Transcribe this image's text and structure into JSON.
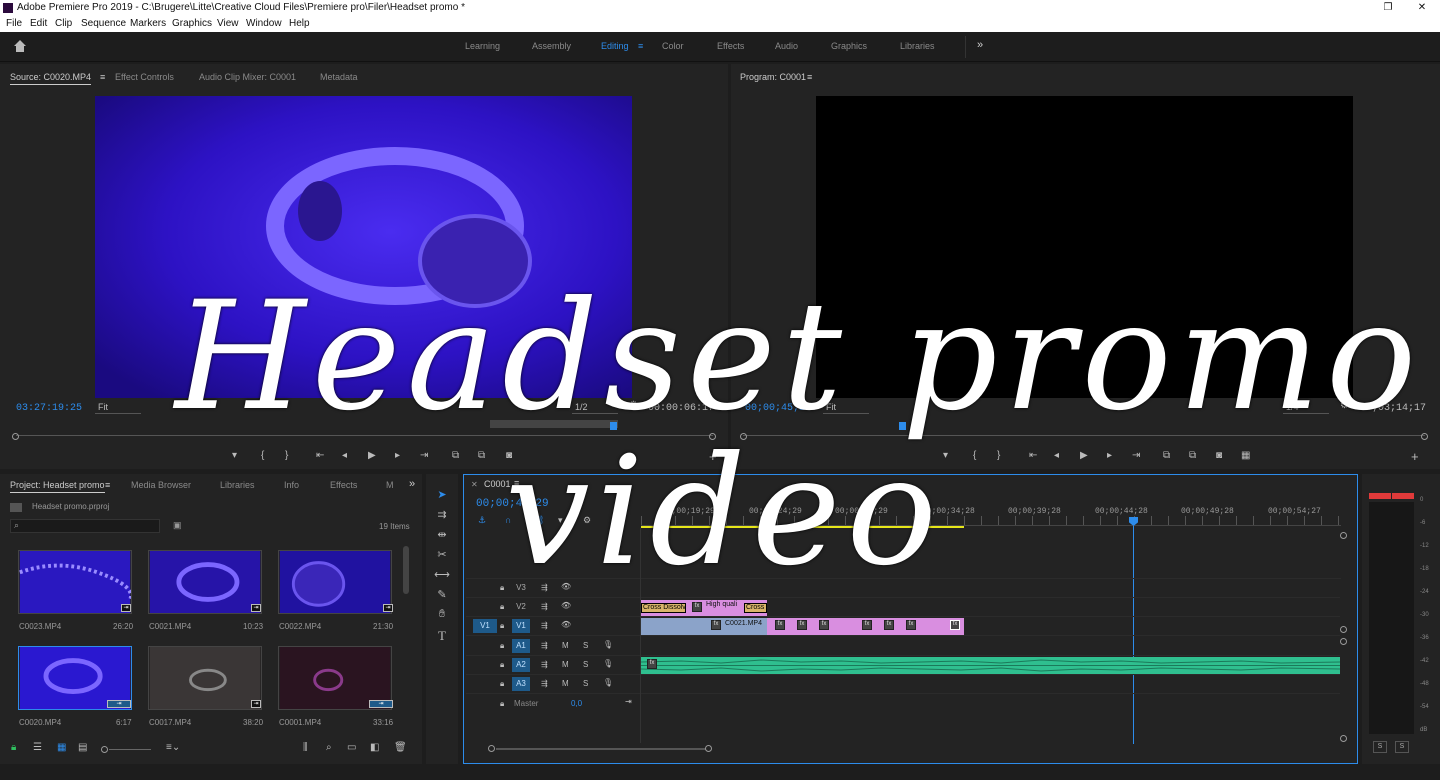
{
  "titlebar": {
    "title": "Adobe Premiere Pro 2019 - C:\\Brugere\\Litte\\Creative Cloud Files\\Premiere pro\\Filer\\Headset promo *",
    "restore": "❐",
    "close": "✕"
  },
  "menu": [
    "File",
    "Edit",
    "Clip",
    "Sequence",
    "Markers",
    "Graphics",
    "View",
    "Window",
    "Help"
  ],
  "workspaces": [
    "Learning",
    "Assembly",
    "Editing",
    "Color",
    "Effects",
    "Audio",
    "Graphics",
    "Libraries"
  ],
  "workspace_active": "Editing",
  "more_glyph": "»",
  "source": {
    "tabs": [
      "Source: C0020.MP4",
      "Effect Controls",
      "Audio Clip Mixer: C0001",
      "Metadata"
    ],
    "timecode": "03:27:19:25",
    "fit": "Fit",
    "resolution": "1/2",
    "duration": "00:00:06:17"
  },
  "program": {
    "tab": "Program: C0001",
    "timecode": "00;00;45;29",
    "fit": "Fit",
    "resolution": "1/4",
    "duration": "00;03;14;17"
  },
  "project": {
    "tabs": [
      "Project: Headset promo",
      "Media Browser",
      "Libraries",
      "Info",
      "Effects",
      "M"
    ],
    "file": "Headset promo.prproj",
    "items_count": "19 Items",
    "clips": [
      {
        "name": "C0023.MP4",
        "duration": "26:20"
      },
      {
        "name": "C0021.MP4",
        "duration": "10:23"
      },
      {
        "name": "C0022.MP4",
        "duration": "21:30"
      },
      {
        "name": "C0020.MP4",
        "duration": "6:17"
      },
      {
        "name": "C0017.MP4",
        "duration": "38:20"
      },
      {
        "name": "C0001.MP4",
        "duration": "33:16"
      }
    ]
  },
  "timeline": {
    "tab": "C0001",
    "timecode": "00;00;45;29",
    "ruler": [
      "00;00;19;29",
      "00;00;24;29",
      "00;00;29;29",
      "00;00;34;28",
      "00;00;39;28",
      "00;00;44;28",
      "00;00;49;28",
      "00;00;54;27"
    ],
    "tracks": {
      "video": [
        "V3",
        "V2",
        "V1"
      ],
      "audio": [
        "A1",
        "A2",
        "A3"
      ],
      "source_patch_v": "V1",
      "source_patch_a": "A1",
      "master": "Master",
      "master_value": "0,0"
    },
    "clips": {
      "cross_dissolve": "Cross Dissolve",
      "high_quality": "High quali",
      "cross_short": "Cross D",
      "v1_clip": "C0021.MP4"
    }
  },
  "meter": {
    "scale": [
      "0",
      "-6",
      "-12",
      "-18",
      "-24",
      "-30",
      "-36",
      "-42",
      "-48",
      "-54",
      "dB"
    ],
    "solo": [
      "S",
      "S"
    ]
  },
  "overlay": {
    "line1": "Headset promo",
    "line2": "video"
  },
  "colors": {
    "accent": "#2d8ceb",
    "v1_clip": "#8ba3c9",
    "video_clip": "#d98ee0",
    "audio_clip": "#2fbf8f",
    "playhead": "#2d8ceb",
    "workarea": "#e6e61a"
  }
}
